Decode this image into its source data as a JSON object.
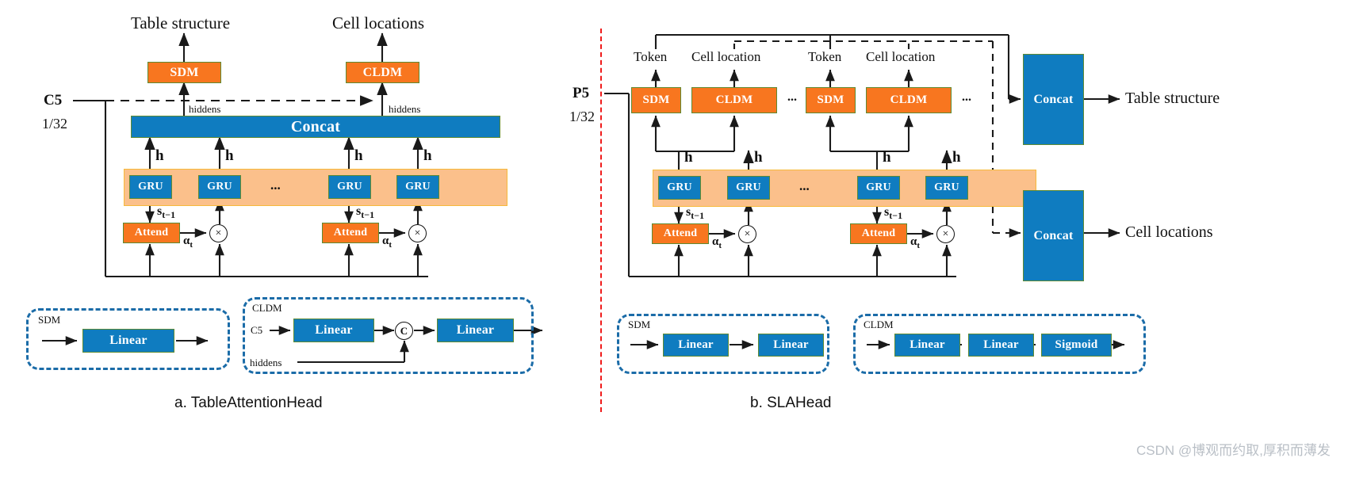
{
  "figure": {
    "caption_a": "a. TableAttentionHead",
    "caption_b": "b. SLAHead",
    "watermark": "CSDN @博观而约取,厚积而薄发",
    "colors": {
      "blue_block": "#0F7CC0",
      "orange_block": "#F8761F",
      "band_fill": "#FBC08B",
      "band_border": "#F6B93B",
      "group_dash": "#1B6CA8",
      "divider": "#EF1B1B",
      "block_border": "#5E8A32",
      "wire": "#1A1A1A",
      "watermark": "#B9BFC6"
    }
  },
  "panel_a": {
    "outputs": {
      "table_structure": "Table structure",
      "cell_locations": "Cell locations"
    },
    "heads": {
      "sdm": "SDM",
      "cldm": "CLDM"
    },
    "hiddens_left": "hiddens",
    "hiddens_right": "hiddens",
    "input": {
      "name": "C5",
      "scale": "1/32"
    },
    "concat": "Concat",
    "h_labels": [
      "h",
      "h",
      "h",
      "h"
    ],
    "gru": [
      "GRU",
      "GRU",
      "GRU",
      "GRU"
    ],
    "ellipsis": "...",
    "state_labels": [
      "s",
      "s"
    ],
    "state_sub": "t−1",
    "attend": [
      "Attend",
      "Attend"
    ],
    "alpha_labels": [
      "α",
      "α"
    ],
    "alpha_sub": "t",
    "mul_symbol": "×",
    "sdm_group": {
      "title": "SDM",
      "blocks": [
        "Linear"
      ]
    },
    "cldm_group": {
      "title": "CLDM",
      "input_label": "C5",
      "hiddens_label": "hiddens",
      "blocks": [
        "Linear",
        "Linear"
      ],
      "concat_symbol": "C"
    }
  },
  "panel_b": {
    "step_labels": [
      "Token",
      "Cell location",
      "Token",
      "Cell location"
    ],
    "heads": [
      "SDM",
      "CLDM",
      "SDM",
      "CLDM"
    ],
    "ellipsis_mid": "...",
    "ellipsis_right": "...",
    "input": {
      "name": "P5",
      "scale": "1/32"
    },
    "h_labels": [
      "h",
      "h",
      "h",
      "h"
    ],
    "gru": [
      "GRU",
      "GRU",
      "GRU",
      "GRU"
    ],
    "gru_ellipsis": "...",
    "state_labels": [
      "s",
      "s"
    ],
    "state_sub": "t−1",
    "attend": [
      "Attend",
      "Attend"
    ],
    "alpha_labels": [
      "α",
      "α"
    ],
    "alpha_sub": "t",
    "mul_symbol": "×",
    "concat_blocks": [
      "Concat",
      "Concat"
    ],
    "outputs": {
      "table_structure": "Table structure",
      "cell_locations": "Cell locations"
    },
    "sdm_group": {
      "title": "SDM",
      "blocks": [
        "Linear",
        "Linear"
      ]
    },
    "cldm_group": {
      "title": "CLDM",
      "blocks": [
        "Linear",
        "Linear",
        "Sigmoid"
      ]
    }
  }
}
